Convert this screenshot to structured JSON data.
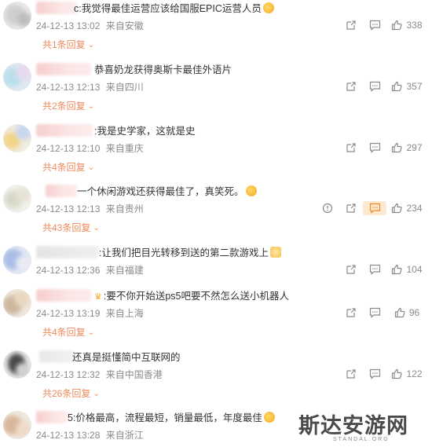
{
  "comments": [
    {
      "text": "c:我觉得最佳运营应该给国服EPIC运营人员",
      "time": "24-12-13 13:02",
      "location": "来自安徽",
      "replies": "共1条回复",
      "likes": "338"
    },
    {
      "text": "恭喜奶龙获得奥斯卡最佳外语片",
      "time": "24-12-13 12:13",
      "location": "来自四川",
      "replies": "共2条回复",
      "likes": "357"
    },
    {
      "text": ":我是史学家，这就是史",
      "time": "24-12-13 12:10",
      "location": "来自重庆",
      "replies": "共4条回复",
      "likes": "297"
    },
    {
      "text": "一个休闲游戏还获得最佳了，真笑死。",
      "time": "24-12-13 12:13",
      "location": "来自贵州",
      "replies": "共43条回复",
      "likes": "234"
    },
    {
      "text": ":让我们把目光转移到送的第二款游戏上",
      "time": "24-12-13 12:36",
      "location": "来自福建",
      "replies": "",
      "likes": "104"
    },
    {
      "text": ":要不你开始送ps5吧要不然怎么送小机器人",
      "time": "24-12-13 13:19",
      "location": "来自上海",
      "replies": "共4条回复",
      "likes": "96"
    },
    {
      "text": "还真是挺懂简中互联网的",
      "time": "24-12-13 12:32",
      "location": "来自中国香港",
      "replies": "共26条回复",
      "likes": "122"
    },
    {
      "text": "5:价格最高，流程最短，销量最低，年度最佳",
      "time": "24-12-13 13:28",
      "location": "来自浙江",
      "replies": "",
      "likes": ""
    }
  ],
  "watermark": {
    "text": "斯达安游网",
    "sub": "STANDAL.ORG"
  }
}
